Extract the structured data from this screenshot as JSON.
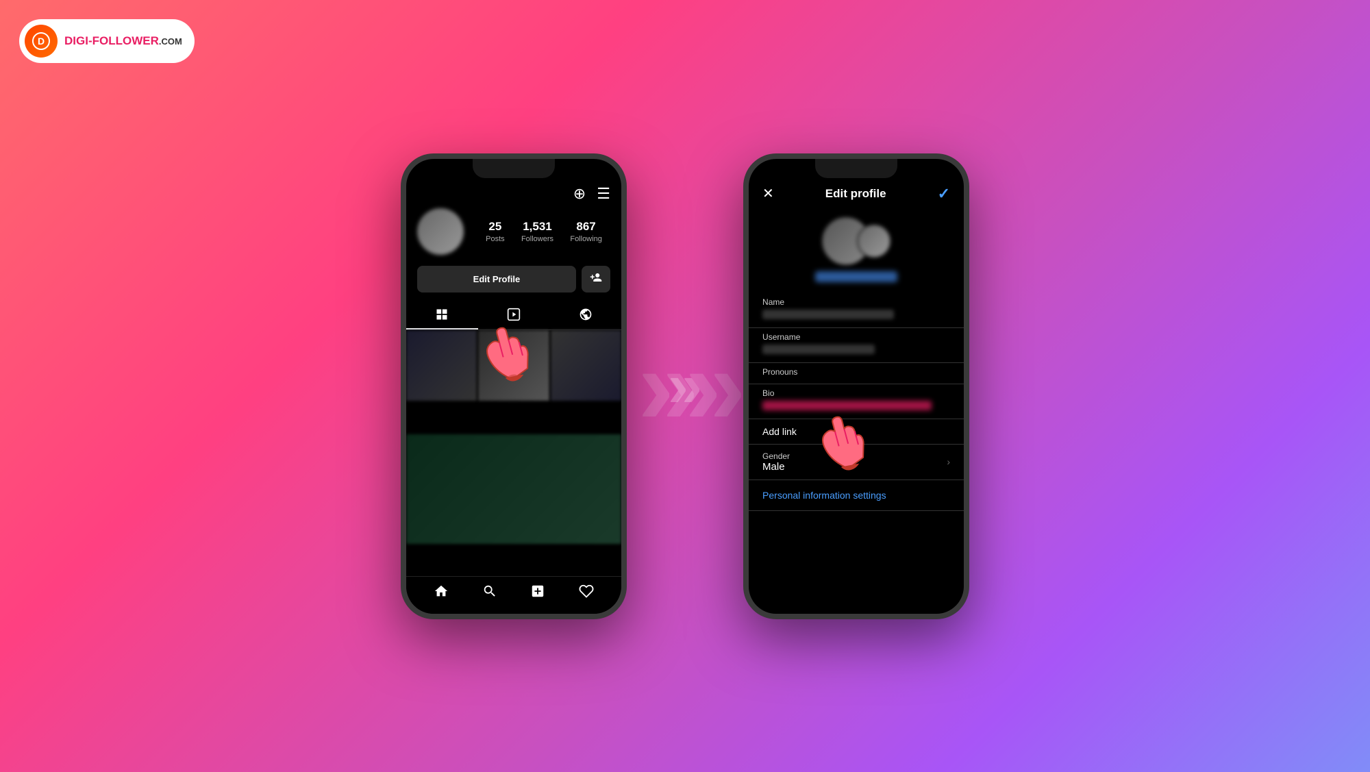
{
  "logo": {
    "icon_text": "D",
    "brand": "DIGI-FOLLOWER",
    "tld": ".COM"
  },
  "phone1": {
    "stats": [
      {
        "number": "25",
        "label": "Posts"
      },
      {
        "number": "1,531",
        "label": "Followers"
      },
      {
        "number": "867",
        "label": "Following"
      }
    ],
    "edit_profile_label": "Edit Profile",
    "tabs": [
      "⊞",
      "▶",
      "👤"
    ],
    "nav_icons": [
      "🏠",
      "🔍",
      "➕",
      "♡"
    ]
  },
  "phone2": {
    "header_title": "Edit profile",
    "fields": [
      {
        "label": "Name",
        "has_value": false
      },
      {
        "label": "Username",
        "has_value": true
      },
      {
        "label": "Pronouns",
        "has_value": false
      },
      {
        "label": "Bio",
        "has_value": true,
        "is_bio": true
      }
    ],
    "add_link_label": "Add link",
    "gender_label": "Gender",
    "gender_value": "Male",
    "personal_info_label": "Personal information settings"
  },
  "arrows": "»»"
}
